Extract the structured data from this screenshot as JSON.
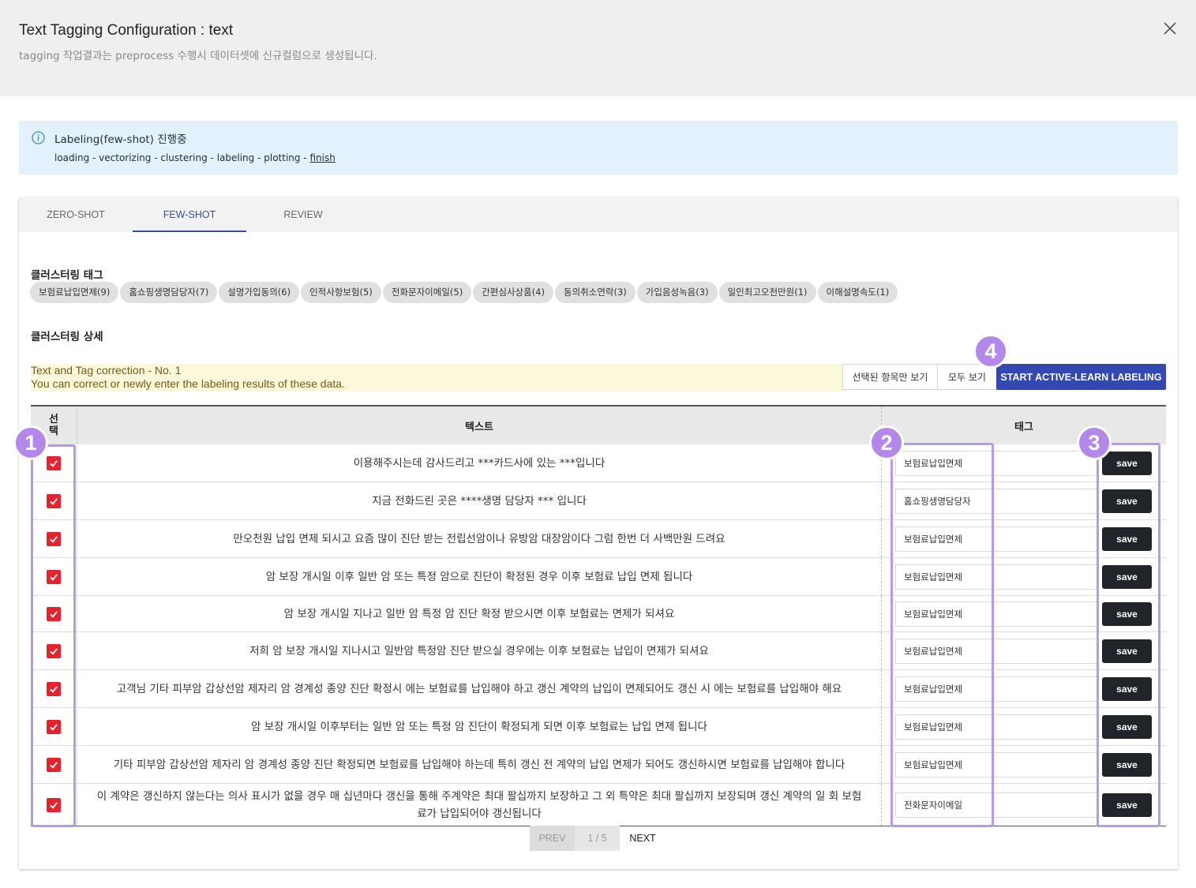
{
  "header": {
    "title": "Text Tagging Configuration : text",
    "subtitle": "tagging 작업결과는 preprocess 수행시 데이터셋에 신규컬럼으로 생성됩니다."
  },
  "status": {
    "title": "Labeling(few-shot) 진행중",
    "steps_prefix": "loading - vectorizing - clustering - labeling - plotting - ",
    "steps_current": "finish"
  },
  "tabs": [
    "ZERO-SHOT",
    "FEW-SHOT",
    "REVIEW"
  ],
  "active_tab": "FEW-SHOT",
  "clustering": {
    "tags_title": "클러스터링 태그",
    "tags": [
      "보험료납입면제(9)",
      "홈쇼핑생명담당자(7)",
      "설명가입동의(6)",
      "인적사항보험(5)",
      "전화문자이메일(5)",
      "간편심사상품(4)",
      "동의취소연락(3)",
      "가입음성녹음(3)",
      "일인최고오천만원(1)",
      "이해설명속도(1)"
    ],
    "detail_title": "클러스터링 상세"
  },
  "correction": {
    "line1": "Text and Tag correction - No. 1",
    "line2": "You can correct or newly enter the labeling results of these data."
  },
  "buttons": {
    "selected_only": "선택된 항목만 보기",
    "show_all": "모두 보기",
    "start": "START ACTIVE-LEARN LABELING",
    "save": "save"
  },
  "table": {
    "headers": {
      "select": "선\n택",
      "text": "텍스트",
      "tag": "태그"
    },
    "rows": [
      {
        "text": "이용해주시는데 감사드리고 ***카드사에 있는 ***입니다",
        "tag": "보험료납입면제",
        "checked": true
      },
      {
        "text": "지금 전화드린 곳은 ****생명 담당자 *** 입니다",
        "tag": "홈쇼핑생명담당자",
        "checked": true
      },
      {
        "text": "만오천원 납입 면제 되시고 요즘 많이 진단 받는 전립선암이나 유방암 대장암이다 그럼 한번 더 사백만원 드려요",
        "tag": "보험료납입면제",
        "checked": true
      },
      {
        "text": "암 보장 개시일 이후 일반 암 또는 특정 암으로 진단이 확정된 경우 이후 보험료 납입 면제 됩니다",
        "tag": "보험료납입면제",
        "checked": true
      },
      {
        "text": "암 보장 개시일 지나고 일반 암 특정 암 진단 확정 받으시면 이후 보험료는 면제가 되셔요",
        "tag": "보험료납입면제",
        "checked": true
      },
      {
        "text": "저희 암 보장 개시일 지나시고 일반암 특정암 진단 받으실 경우에는 이후 보험료는 납입이 면제가 되셔요",
        "tag": "보험료납입면제",
        "checked": true
      },
      {
        "text": "고객님 기타 피부암 갑상선암 제자리 암 경계성 종양 진단 확정시 에는 보험료를 납입해야 하고 갱신 계약의 납입이 면제되어도 갱신 시 에는 보험료를 납입해야 해요",
        "tag": "보험료납입면제",
        "checked": true
      },
      {
        "text": "암 보장 개시일 이후부터는 일반 암 또는 특정 암 진단이 확정되게 되면 이후 보험료는 납입 면제 됩니다",
        "tag": "보험료납입면제",
        "checked": true
      },
      {
        "text": "기타 피부암 갑상선암 제자리 암 경계성 종양 진단 확정되면 보험료를 납입해야 하는데 특히 갱신 전 계약의 납입 면제가 되어도 갱신하시면 보험료를 납입해야 합니다",
        "tag": "보험료납입면제",
        "checked": true
      },
      {
        "text": "이 계약은 갱신하지 않는다는 의사 표시가 없을 경우 매 십년마다 갱신을 통해 주계약은 최대 팔십까지 보장하고 그 외 특약은 최대 팔십까지 보장되며 갱신 계약의 일 회 보험료가 납입되어야 갱신됩니다",
        "tag": "전화문자이메일",
        "checked": true
      }
    ]
  },
  "pagination": {
    "prev": "PREV",
    "position": "1 / 5",
    "next": "NEXT"
  },
  "callouts": [
    "1",
    "2",
    "3",
    "4"
  ],
  "colors": {
    "accent": "#3348b0",
    "checkbox": "#e8222d",
    "callout": "#b388ea",
    "info_bg": "#e3f1fc",
    "notice_bg": "#fbf8dc"
  }
}
